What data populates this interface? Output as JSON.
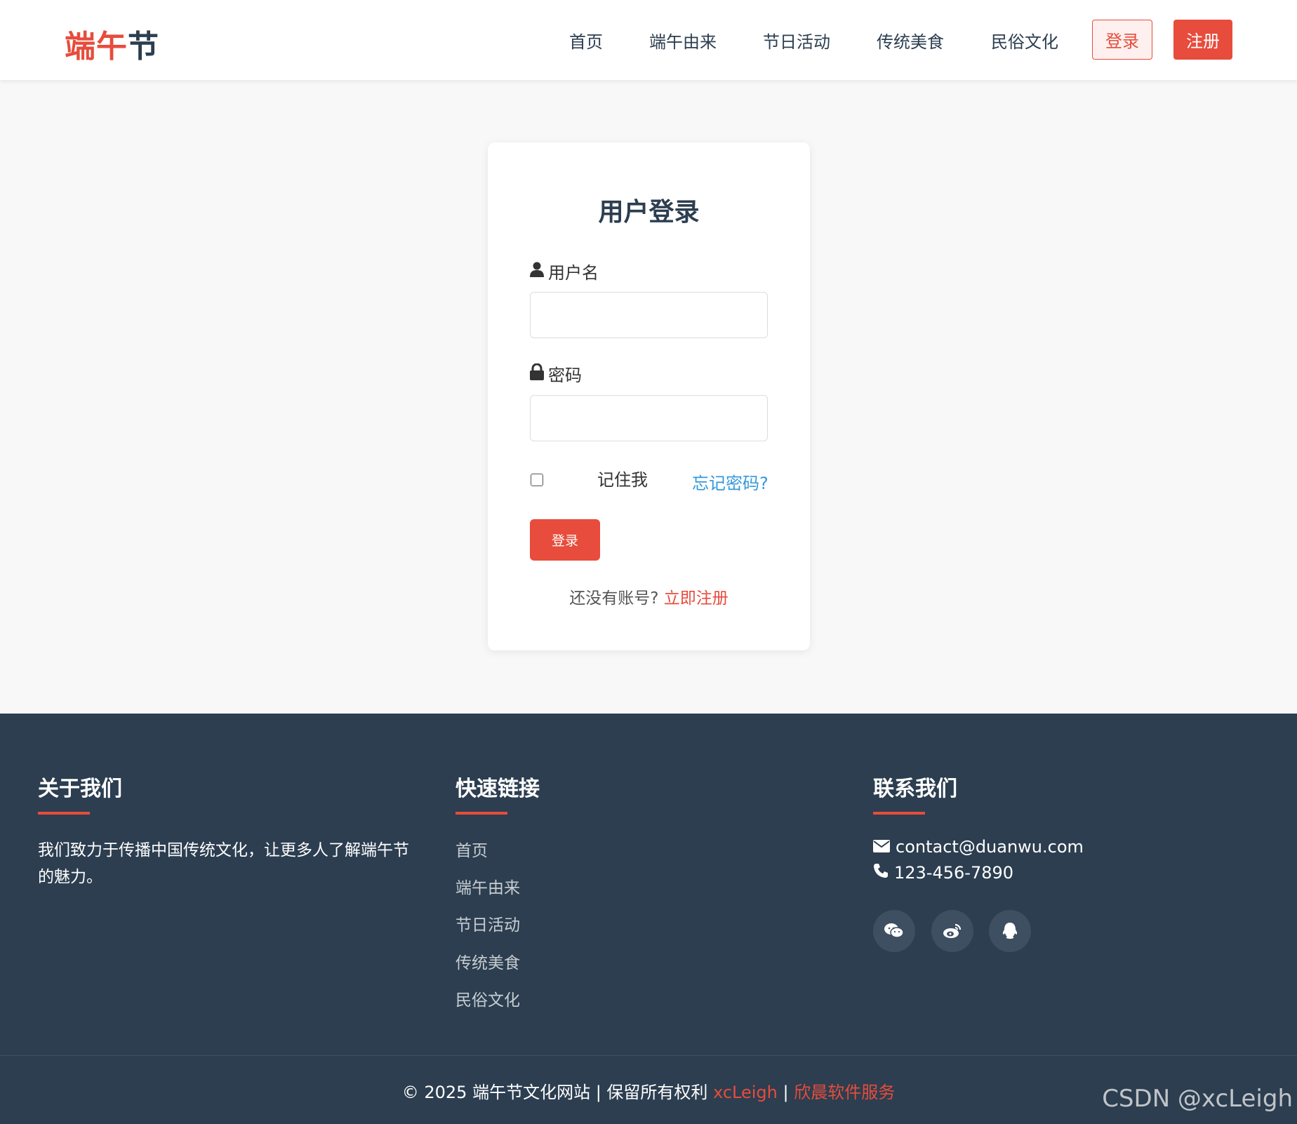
{
  "header": {
    "logo_part1": "端午",
    "logo_part2": "节",
    "nav": [
      {
        "label": "首页"
      },
      {
        "label": "端午由来"
      },
      {
        "label": "节日活动"
      },
      {
        "label": "传统美食"
      },
      {
        "label": "民俗文化"
      }
    ],
    "login_label": "登录",
    "register_label": "注册"
  },
  "login_card": {
    "title": "用户登录",
    "username_label": "用户名",
    "username_value": "",
    "password_label": "密码",
    "password_value": "",
    "remember_label": "记住我",
    "remember_checked": false,
    "forgot_label": "忘记密码?",
    "submit_label": "登录",
    "no_account_text": "还没有账号?",
    "register_link": "立即注册"
  },
  "footer": {
    "about": {
      "title": "关于我们",
      "text": "我们致力于传播中国传统文化，让更多人了解端午节的魅力。"
    },
    "quick_links": {
      "title": "快速链接",
      "items": [
        "首页",
        "端午由来",
        "节日活动",
        "传统美食",
        "民俗文化"
      ]
    },
    "contact": {
      "title": "联系我们",
      "email": "contact@duanwu.com",
      "phone": "123-456-7890",
      "socials": [
        "wechat-icon",
        "weibo-icon",
        "qq-icon"
      ]
    },
    "copyright_text": "© 2025 端午节文化网站 | 保留所有权利",
    "copyright_author": "xcLeigh",
    "copyright_sep": "|",
    "copyright_company": "欣晨软件服务"
  },
  "watermark": "CSDN @xcLeigh",
  "colors": {
    "accent": "#e74c3c",
    "dark": "#2c3e50",
    "link_blue": "#3498db"
  }
}
